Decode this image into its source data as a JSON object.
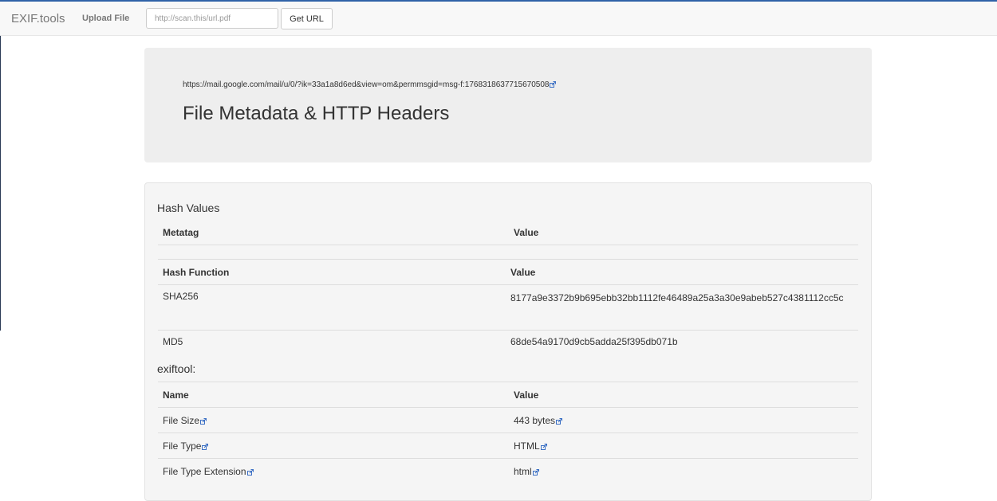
{
  "nav": {
    "brand": "EXIF.tools",
    "upload_label": "Upload File",
    "url_placeholder": "http://scan.this/url.pdf",
    "url_value": "",
    "get_url_label": "Get URL"
  },
  "header": {
    "source_url": "https://mail.google.com/mail/u/0/?ik=33a1a8d6ed&view=om&permmsgid=msg-f:1768318637715670508",
    "title": "File Metadata & HTTP Headers"
  },
  "hash_section": {
    "title": "Hash Values",
    "meta_header": {
      "col1": "Metatag",
      "col2": "Value"
    },
    "hash_header": {
      "col1": "Hash Function",
      "col2": "Value"
    },
    "rows": [
      {
        "name": "SHA256",
        "value": "8177a9e3372b9b695ebb32bb1112fe46489a25a3a30e9abeb527c4381112cc5c"
      },
      {
        "name": "MD5",
        "value": "68de54a9170d9cb5adda25f395db071b"
      }
    ]
  },
  "exif_section": {
    "title": "exiftool:",
    "header": {
      "col1": "Name",
      "col2": "Value"
    },
    "rows": [
      {
        "name": "File Size",
        "value": "443 bytes"
      },
      {
        "name": "File Type",
        "value": "HTML"
      },
      {
        "name": "File Type Extension",
        "value": "html"
      }
    ]
  },
  "icons": {
    "external_link": "external-link-icon"
  },
  "colors": {
    "link_icon": "#3b6fc4",
    "top_border": "#2f62a8"
  }
}
